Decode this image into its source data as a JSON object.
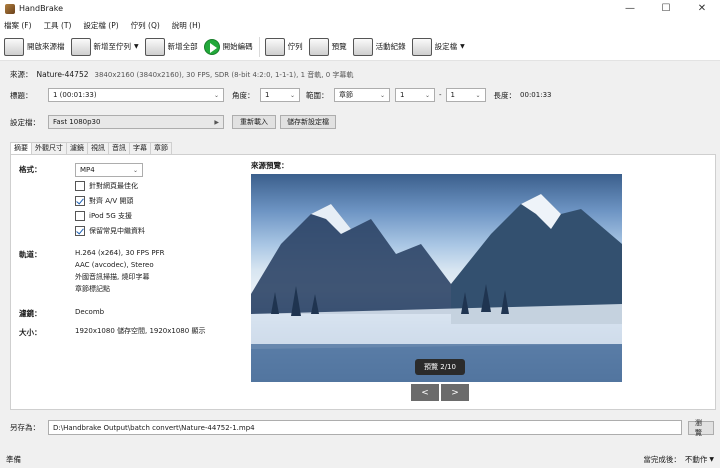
{
  "window": {
    "title": "HandBrake",
    "minimize": "—",
    "maximize": "☐",
    "close": "✕"
  },
  "menu": [
    "檔案 (F)",
    "工具 (T)",
    "設定檔 (P)",
    "佇列 (Q)",
    "說明 (H)"
  ],
  "toolbar": {
    "open_source": "開啟來源檔",
    "add_to_queue": "新增至佇列",
    "add_all": "新增全部",
    "start_encode": "開始編碼",
    "queue": "佇列",
    "preview": "預覽",
    "activity_log": "活動紀錄",
    "presets": "設定檔"
  },
  "source": {
    "label": "來源：",
    "name": "Nature-44752",
    "info": "3840x2160 (3840x2160), 30 FPS, SDR (8-bit 4:2:0, 1-1-1), 1 音軌, 0 字幕軌"
  },
  "title_row": {
    "title_label": "標題：",
    "title_value": "1 (00:01:33)",
    "angle_label": "角度：",
    "angle_value": "1",
    "range_label": "範圍：",
    "range_type": "章節",
    "range_from": "1",
    "range_dash": "-",
    "range_to": "1",
    "duration_label": "長度：",
    "duration_value": "00:01:33"
  },
  "preset_row": {
    "label": "設定檔：",
    "value": "Fast 1080p30",
    "reload": "重新載入",
    "save_new": "儲存新設定檔"
  },
  "tabs": [
    "摘要",
    "外觀尺寸",
    "濾鏡",
    "視訊",
    "音訊",
    "字幕",
    "章節"
  ],
  "summary": {
    "format_label": "格式：",
    "format_value": "MP4",
    "options": [
      {
        "label": "針對網頁最佳化",
        "checked": false
      },
      {
        "label": "對齊 A/V 開頭",
        "checked": true
      },
      {
        "label": "iPod 5G 支援",
        "checked": false
      },
      {
        "label": "保留常見中繼資料",
        "checked": true
      }
    ],
    "tracks_label": "軌道：",
    "tracks": [
      "H.264 (x264), 30 FPS PFR",
      "AAC (avcodec), Stereo",
      "外國音訊掃描, 燒印字幕",
      "章節標記點"
    ],
    "filters_label": "濾鏡：",
    "filters_value": "Decomb",
    "size_label": "大小：",
    "size_value": "1920x1080 儲存空間, 1920x1080 顯示"
  },
  "preview": {
    "label": "來源預覽：",
    "counter": "預覽 2/10",
    "prev": "<",
    "next": ">"
  },
  "save_as": {
    "label": "另存為：",
    "path": "D:\\Handbrake Output\\batch convert\\Nature-44752-1.mp4",
    "browse": "瀏覽"
  },
  "status": {
    "text": "準備",
    "when_done_label": "當完成後：",
    "when_done_value": "不動作"
  }
}
